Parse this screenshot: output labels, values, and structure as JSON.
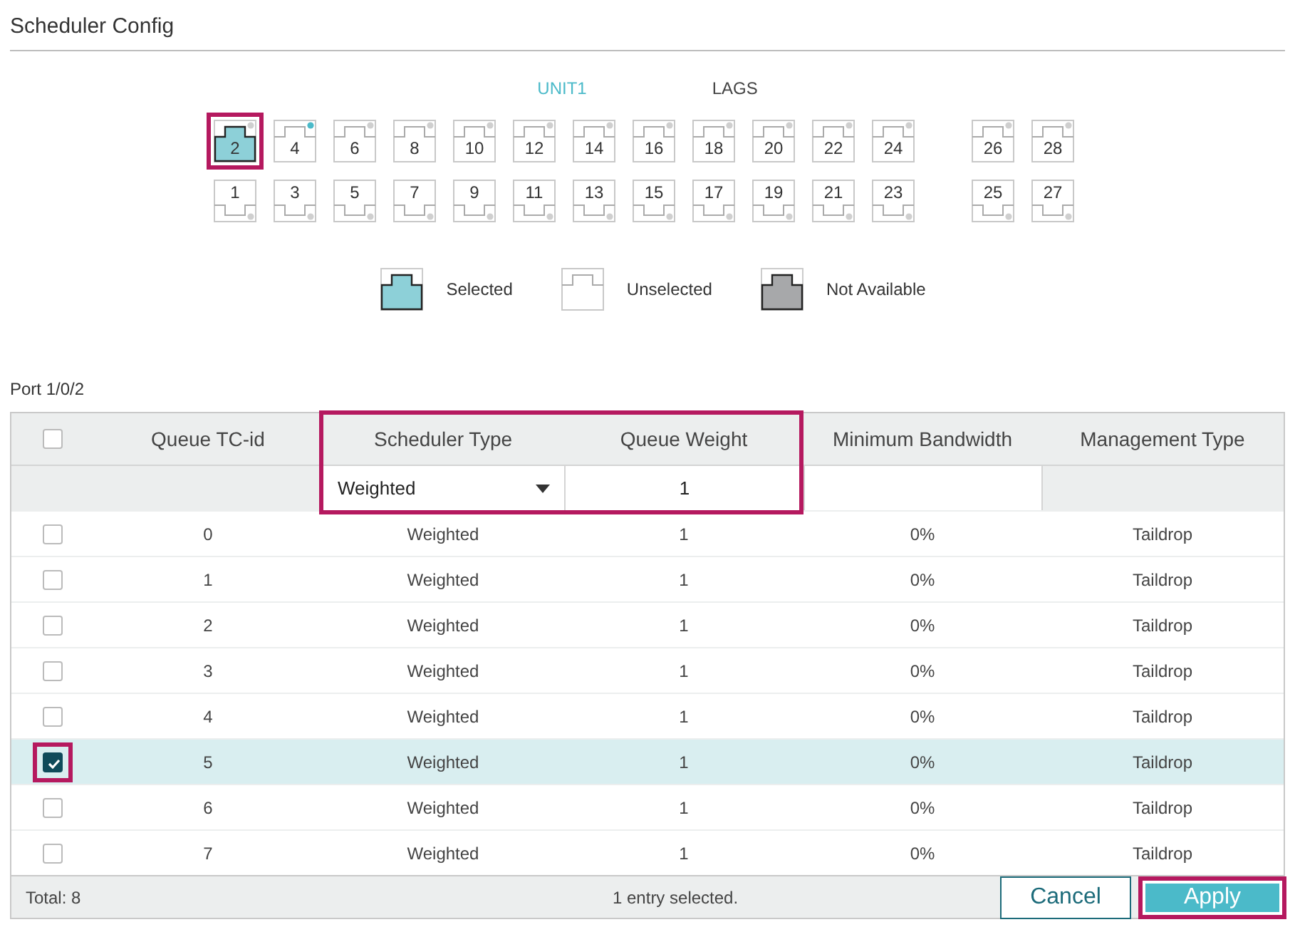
{
  "title": "Scheduler Config",
  "tabs": [
    {
      "label": "UNIT1",
      "selected": true
    },
    {
      "label": "LAGS",
      "selected": false
    }
  ],
  "port_rows": [
    {
      "kind": "upper",
      "groups": [
        [
          {
            "label": "2",
            "selected": true,
            "linked": false,
            "highlighted": true
          },
          {
            "label": "4",
            "selected": false,
            "linked": true,
            "highlighted": false
          },
          {
            "label": "6",
            "selected": false,
            "linked": false,
            "highlighted": false
          },
          {
            "label": "8",
            "selected": false,
            "linked": false,
            "highlighted": false
          },
          {
            "label": "10",
            "selected": false,
            "linked": false,
            "highlighted": false
          },
          {
            "label": "12",
            "selected": false,
            "linked": false,
            "highlighted": false
          },
          {
            "label": "14",
            "selected": false,
            "linked": false,
            "highlighted": false
          },
          {
            "label": "16",
            "selected": false,
            "linked": false,
            "highlighted": false
          },
          {
            "label": "18",
            "selected": false,
            "linked": false,
            "highlighted": false
          },
          {
            "label": "20",
            "selected": false,
            "linked": false,
            "highlighted": false
          },
          {
            "label": "22",
            "selected": false,
            "linked": false,
            "highlighted": false
          },
          {
            "label": "24",
            "selected": false,
            "linked": false,
            "highlighted": false
          }
        ],
        [
          {
            "label": "26",
            "selected": false,
            "linked": false,
            "highlighted": false
          },
          {
            "label": "28",
            "selected": false,
            "linked": false,
            "highlighted": false
          }
        ]
      ]
    },
    {
      "kind": "lower",
      "groups": [
        [
          {
            "label": "1",
            "selected": false,
            "linked": false,
            "highlighted": false
          },
          {
            "label": "3",
            "selected": false,
            "linked": false,
            "highlighted": false
          },
          {
            "label": "5",
            "selected": false,
            "linked": false,
            "highlighted": false
          },
          {
            "label": "7",
            "selected": false,
            "linked": false,
            "highlighted": false
          },
          {
            "label": "9",
            "selected": false,
            "linked": false,
            "highlighted": false
          },
          {
            "label": "11",
            "selected": false,
            "linked": false,
            "highlighted": false
          },
          {
            "label": "13",
            "selected": false,
            "linked": false,
            "highlighted": false
          },
          {
            "label": "15",
            "selected": false,
            "linked": false,
            "highlighted": false
          },
          {
            "label": "17",
            "selected": false,
            "linked": false,
            "highlighted": false
          },
          {
            "label": "19",
            "selected": false,
            "linked": false,
            "highlighted": false
          },
          {
            "label": "21",
            "selected": false,
            "linked": false,
            "highlighted": false
          },
          {
            "label": "23",
            "selected": false,
            "linked": false,
            "highlighted": false
          }
        ],
        [
          {
            "label": "25",
            "selected": false,
            "linked": false,
            "highlighted": false
          },
          {
            "label": "27",
            "selected": false,
            "linked": false,
            "highlighted": false
          }
        ]
      ]
    }
  ],
  "legend": [
    {
      "kind": "selected",
      "label": "Selected"
    },
    {
      "kind": "unselected",
      "label": "Unselected"
    },
    {
      "kind": "unavailable",
      "label": "Not Available"
    }
  ],
  "port_caption": "Port 1/0/2",
  "table": {
    "select_all": {
      "checked": false
    },
    "columns": [
      "Queue TC-id",
      "Scheduler Type",
      "Queue Weight",
      "Minimum Bandwidth",
      "Management Type"
    ],
    "filter": {
      "scheduler_type": "Weighted",
      "queue_weight": "1",
      "highlighted": true
    },
    "rows": [
      {
        "checked": false,
        "highlighted": false,
        "tc_id": "0",
        "scheduler_type": "Weighted",
        "queue_weight": "1",
        "min_bandwidth": "0%",
        "management_type": "Taildrop"
      },
      {
        "checked": false,
        "highlighted": false,
        "tc_id": "1",
        "scheduler_type": "Weighted",
        "queue_weight": "1",
        "min_bandwidth": "0%",
        "management_type": "Taildrop"
      },
      {
        "checked": false,
        "highlighted": false,
        "tc_id": "2",
        "scheduler_type": "Weighted",
        "queue_weight": "1",
        "min_bandwidth": "0%",
        "management_type": "Taildrop"
      },
      {
        "checked": false,
        "highlighted": false,
        "tc_id": "3",
        "scheduler_type": "Weighted",
        "queue_weight": "1",
        "min_bandwidth": "0%",
        "management_type": "Taildrop"
      },
      {
        "checked": false,
        "highlighted": false,
        "tc_id": "4",
        "scheduler_type": "Weighted",
        "queue_weight": "1",
        "min_bandwidth": "0%",
        "management_type": "Taildrop"
      },
      {
        "checked": true,
        "highlighted": true,
        "tc_id": "5",
        "scheduler_type": "Weighted",
        "queue_weight": "1",
        "min_bandwidth": "0%",
        "management_type": "Taildrop"
      },
      {
        "checked": false,
        "highlighted": false,
        "tc_id": "6",
        "scheduler_type": "Weighted",
        "queue_weight": "1",
        "min_bandwidth": "0%",
        "management_type": "Taildrop"
      },
      {
        "checked": false,
        "highlighted": false,
        "tc_id": "7",
        "scheduler_type": "Weighted",
        "queue_weight": "1",
        "min_bandwidth": "0%",
        "management_type": "Taildrop"
      }
    ],
    "total": "Total: 8",
    "selection_note": "1 entry selected."
  },
  "buttons": [
    {
      "label": "Cancel",
      "kind": "secondary",
      "highlighted": false
    },
    {
      "label": "Apply",
      "kind": "primary",
      "highlighted": true
    }
  ]
}
